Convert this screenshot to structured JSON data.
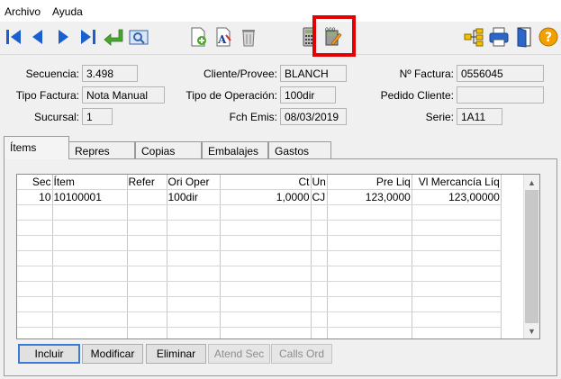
{
  "menu": {
    "file": "Archivo",
    "help": "Ayuda"
  },
  "toolbar": {
    "buttons": [
      "first-record-icon",
      "previous-record-icon",
      "next-record-icon",
      "last-record-icon",
      "return-icon",
      "preview-icon",
      "new-document-icon",
      "text-format-icon",
      "trash-icon",
      "calculator-icon",
      "edit-document-icon",
      "hierarchy-icon",
      "print-icon",
      "exit-door-icon",
      "help-icon"
    ],
    "colors": {
      "nav_blue": "#1a5fd0",
      "return_green": "#4aa52e",
      "help_orange": "#f2a000",
      "highlight_red": "#e30000"
    }
  },
  "header": {
    "secuencia_label": "Secuencia:",
    "secuencia_value": "3.498",
    "cliente_label": "Cliente/Provee:",
    "cliente_value": "BLANCH",
    "factura_label": "Nº Factura:",
    "factura_value": "0556045",
    "tipo_factura_label": "Tipo Factura:",
    "tipo_factura_value": "Nota Manual",
    "tipo_operacion_label": "Tipo de Operación:",
    "tipo_operacion_value": "100dir",
    "pedido_label": "Pedido Cliente:",
    "pedido_value": "",
    "sucursal_label": "Sucursal:",
    "sucursal_value": "1",
    "fch_emis_label": "Fch Emis:",
    "fch_emis_value": "08/03/2019",
    "serie_label": "Serie:",
    "serie_value": "1A11"
  },
  "tabs": [
    {
      "label": "Ítems"
    },
    {
      "label": "Repres"
    },
    {
      "label": "Copias"
    },
    {
      "label": "Embalajes"
    },
    {
      "label": "Gastos"
    }
  ],
  "grid": {
    "columns": [
      "Sec",
      "Ítem",
      "Refer",
      "Ori Oper",
      "Ct",
      "Un",
      "Pre Liq",
      "Vl Mercancía Líq"
    ],
    "rows": [
      [
        "10",
        "10100001",
        "",
        "100dir",
        "1,0000",
        "CJ",
        "123,0000",
        "123,00000"
      ]
    ]
  },
  "buttons": {
    "incluir": "Incluir",
    "modificar": "Modificar",
    "eliminar": "Eliminar",
    "atend_sec": "Atend Sec",
    "calls_ord": "Calls Ord"
  }
}
